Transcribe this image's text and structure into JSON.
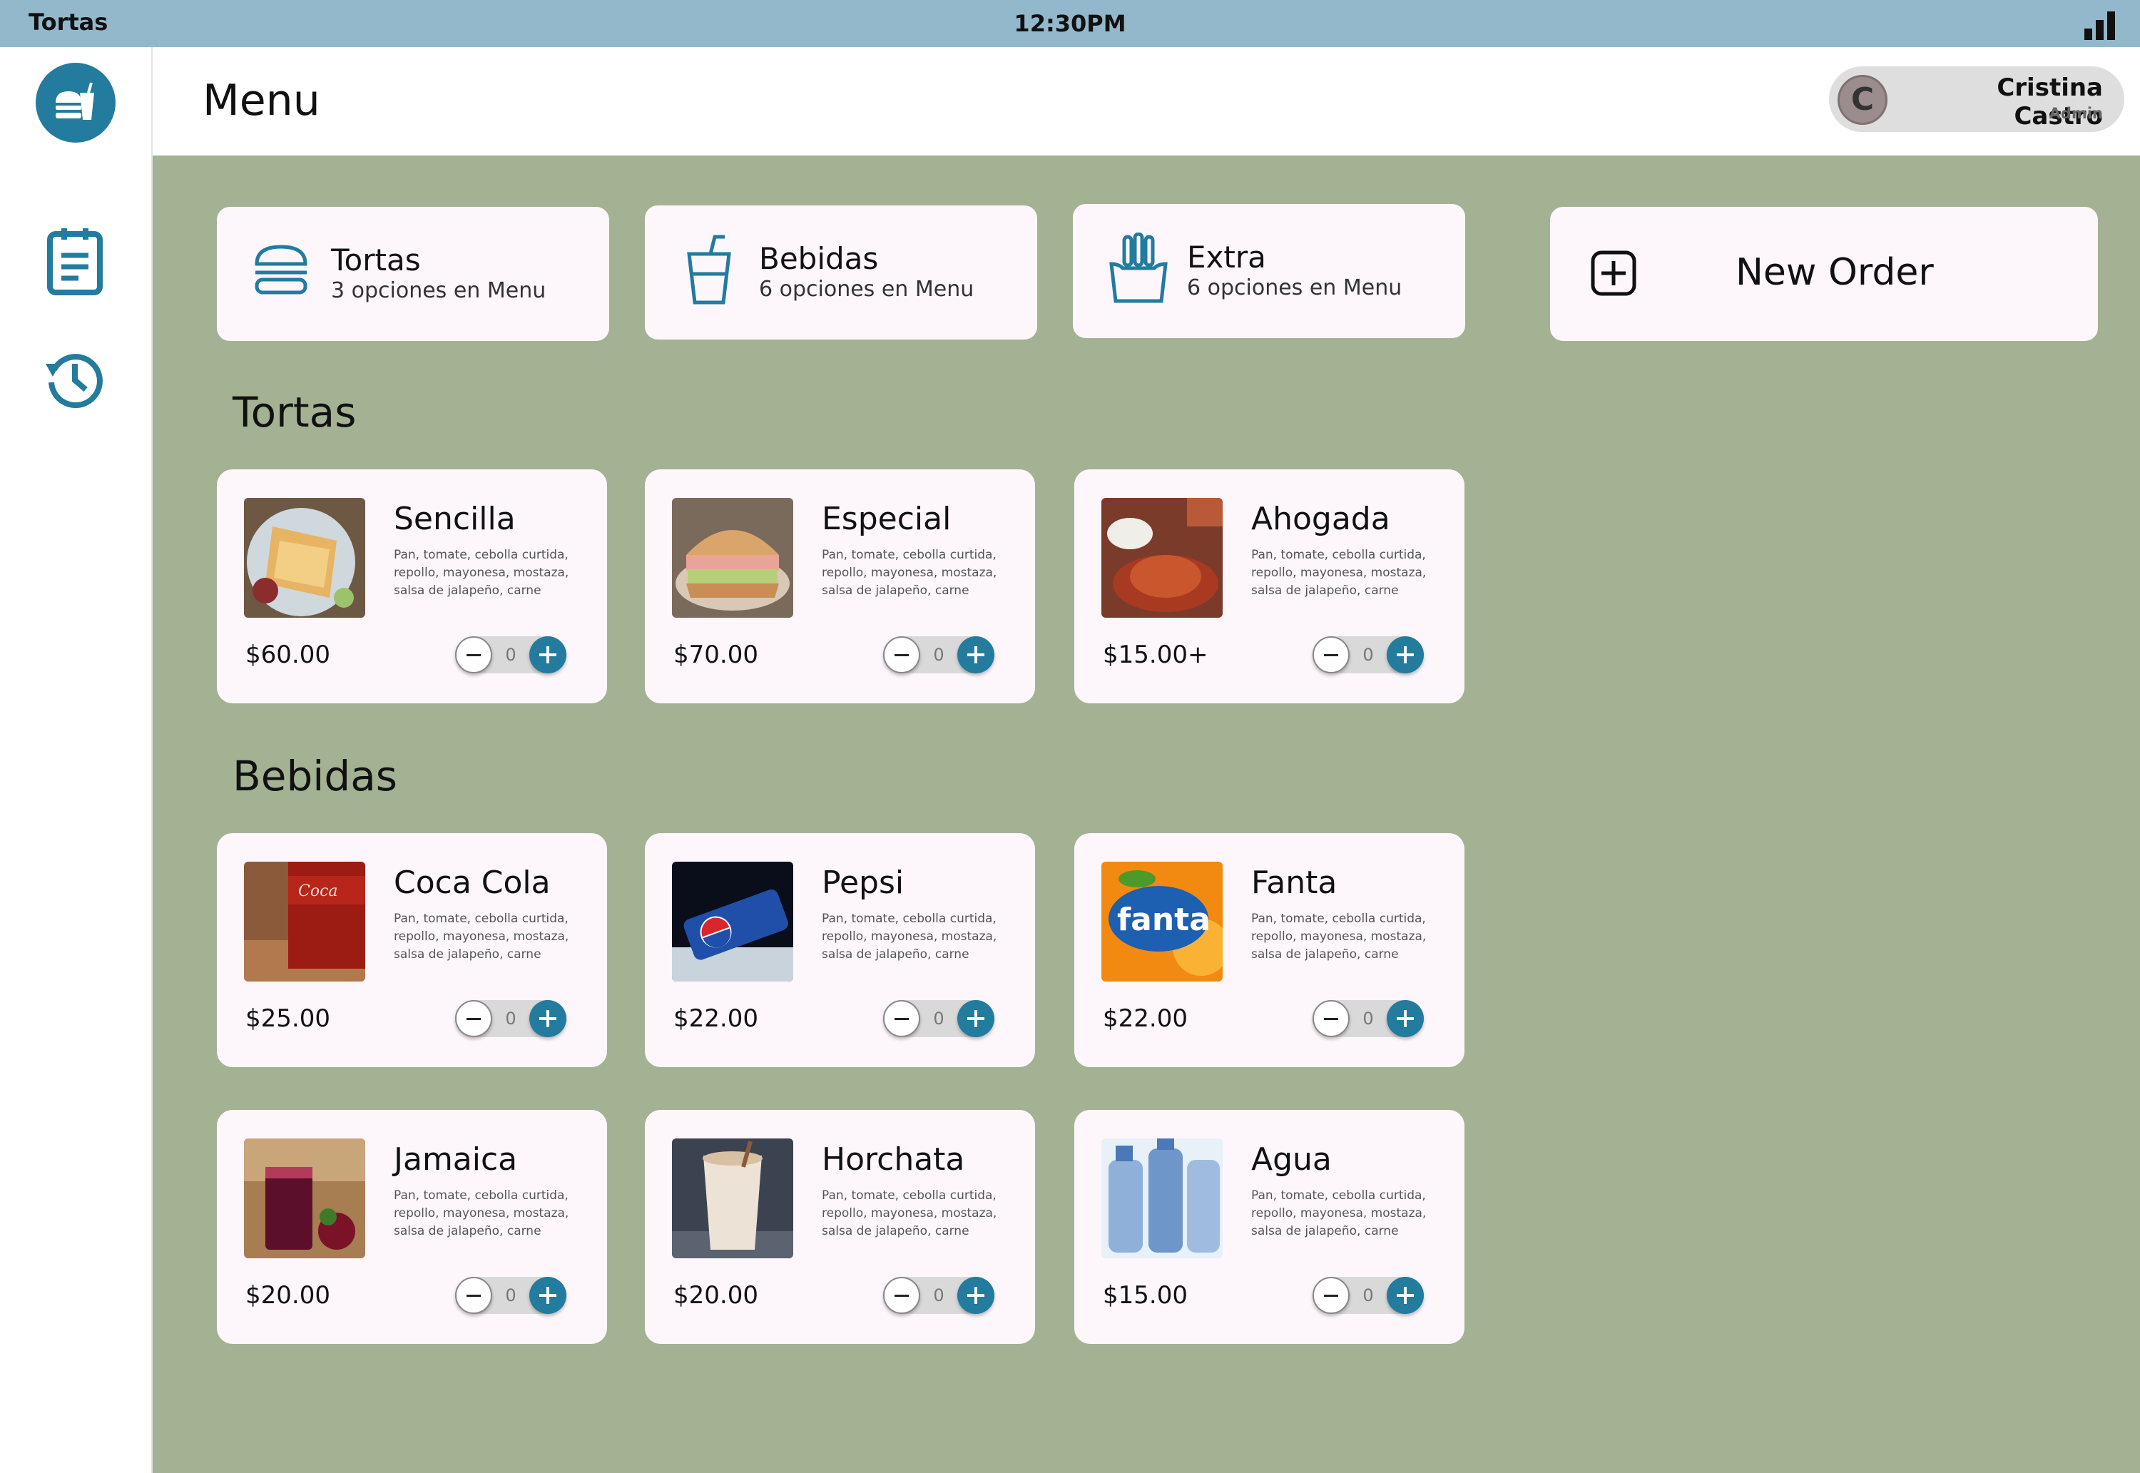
{
  "status_bar": {
    "app_name": "Tortas",
    "time": "12:30PM"
  },
  "header": {
    "title": "Menu",
    "user": {
      "initial": "C",
      "name": "Cristina Castro",
      "role": "Admin"
    }
  },
  "sidebar": {
    "items": [
      {
        "icon": "orders-clipboard-icon"
      },
      {
        "icon": "history-icon"
      }
    ]
  },
  "categories": [
    {
      "name": "Tortas",
      "count": "3 opciones en Menu",
      "icon": "burger-icon"
    },
    {
      "name": "Bebidas",
      "count": "6 opciones en Menu",
      "icon": "drink-cup-icon"
    },
    {
      "name": "Extra",
      "count": "6 opciones en Menu",
      "icon": "fries-icon"
    }
  ],
  "new_order": {
    "label": "New Order"
  },
  "sections": [
    {
      "title": "Tortas"
    },
    {
      "title": "Bebidas"
    }
  ],
  "items": [
    {
      "name": "Sencilla",
      "desc": "Pan, tomate, cebolla curtida, repollo, mayonesa, mostaza, salsa de jalapeño, carne",
      "price": "$60.00",
      "qty": "0"
    },
    {
      "name": "Especial",
      "desc": "Pan, tomate, cebolla curtida, repollo, mayonesa, mostaza, salsa de jalapeño, carne",
      "price": "$70.00",
      "qty": "0"
    },
    {
      "name": "Ahogada",
      "desc": "Pan, tomate, cebolla curtida, repollo, mayonesa, mostaza, salsa de jalapeño, carne",
      "price": "$15.00+",
      "qty": "0"
    },
    {
      "name": "Coca Cola",
      "desc": "Pan, tomate, cebolla curtida, repollo, mayonesa, mostaza, salsa de jalapeño, carne",
      "price": "$25.00",
      "qty": "0"
    },
    {
      "name": "Pepsi",
      "desc": "Pan, tomate, cebolla curtida, repollo, mayonesa, mostaza, salsa de jalapeño, carne",
      "price": "$22.00",
      "qty": "0"
    },
    {
      "name": "Fanta",
      "desc": "Pan, tomate, cebolla curtida, repollo, mayonesa, mostaza, salsa de jalapeño, carne",
      "price": "$22.00",
      "qty": "0"
    },
    {
      "name": "Jamaica",
      "desc": "Pan, tomate, cebolla curtida, repollo, mayonesa, mostaza, salsa de jalapeño, carne",
      "price": "$20.00",
      "qty": "0"
    },
    {
      "name": "Horchata",
      "desc": "Pan, tomate, cebolla curtida, repollo, mayonesa, mostaza, salsa de jalapeño, carne",
      "price": "$20.00",
      "qty": "0"
    },
    {
      "name": "Agua",
      "desc": "Pan, tomate, cebolla curtida, repollo, mayonesa, mostaza, salsa de jalapeño, carne",
      "price": "$15.00",
      "qty": "0"
    }
  ],
  "colors": {
    "accent": "#237b9e",
    "status_bar": "#93b8cb",
    "main_bg": "#a4b294",
    "card_bg": "#fdf7fc"
  }
}
